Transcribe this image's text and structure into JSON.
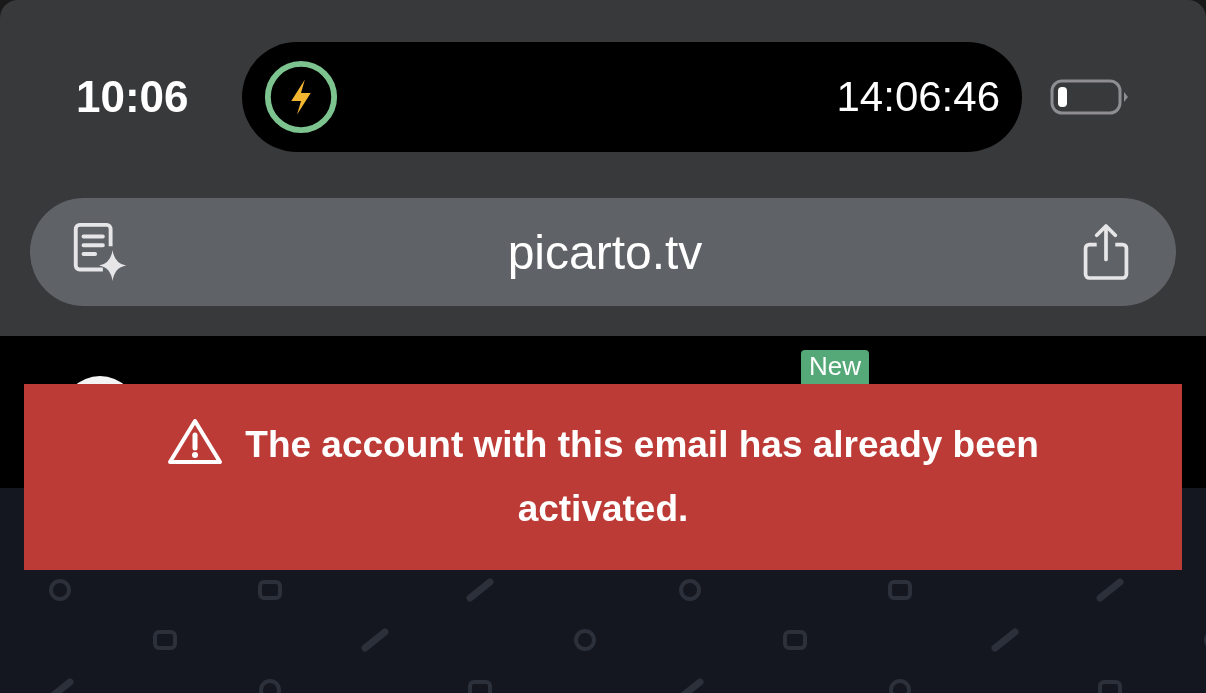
{
  "status_bar": {
    "time": "10:06",
    "live_activity": {
      "elapsed": "14:06:46"
    }
  },
  "address_bar": {
    "url": "picarto.tv"
  },
  "site_header": {
    "badge": "New"
  },
  "alert": {
    "kind": "error",
    "message": "The account with this email has already been activated."
  }
}
